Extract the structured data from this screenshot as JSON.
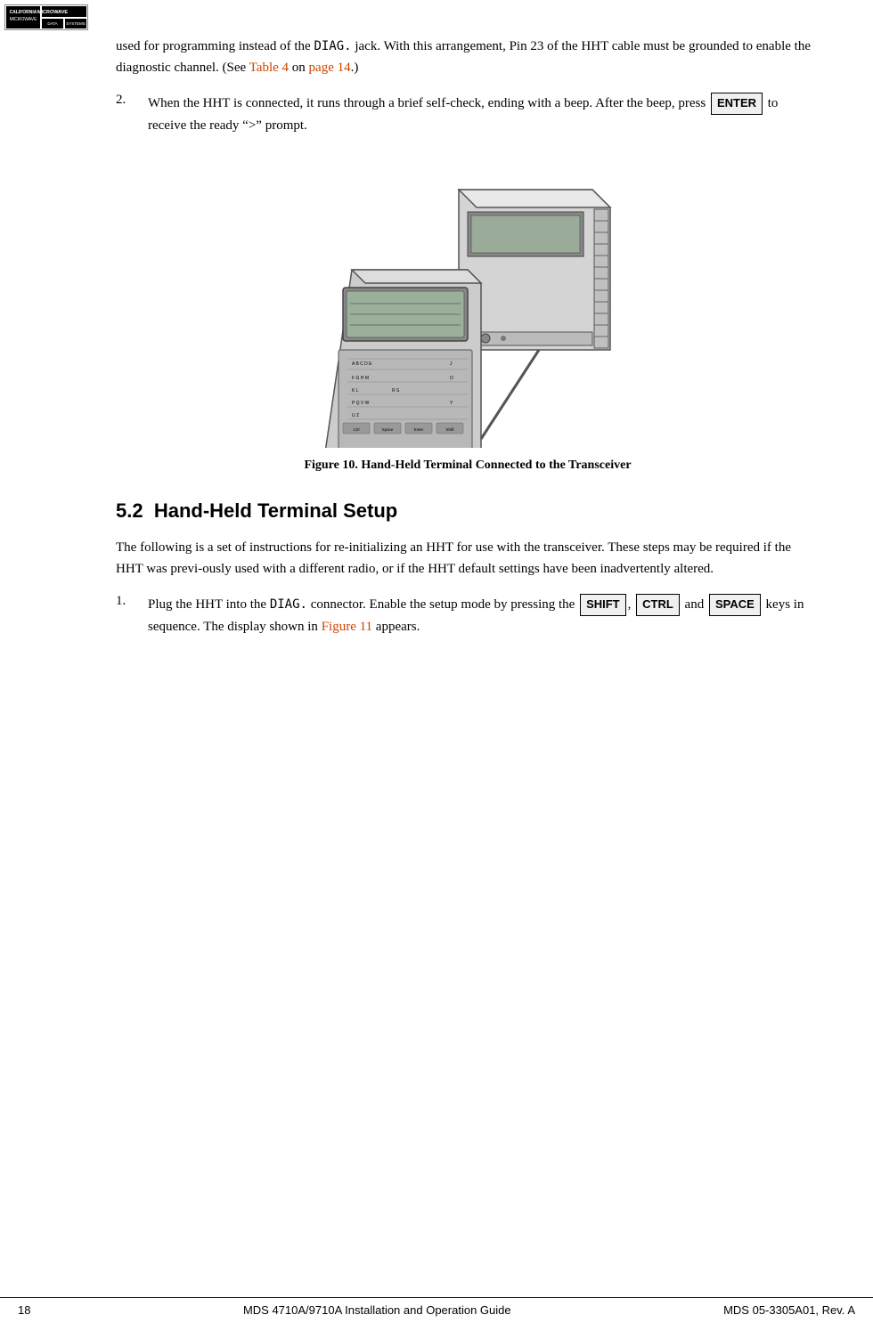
{
  "logo": {
    "line1": "CALIFORNIA",
    "line2": "MicrOWAVE",
    "line3": "DATA",
    "line4": "SYSTEMS"
  },
  "content": {
    "intro_para": "used for programming instead of the DIAG. jack. With this arrange-ment, Pin 23 of the HHT cable must be grounded to enable the diag-nostic channel. (See Table 4 on page 14.)",
    "table_link": "Table 4",
    "page_link": "page 14",
    "item2_text_pre": "When the HHT is connected, it runs through a brief self-check, ending with a beep. After the beep, press ",
    "item2_key": "ENTER",
    "item2_text_post": " to receive the ready “>” prompt.",
    "figure_caption": "Figure 10. Hand-Held Terminal Connected to the Transceiver",
    "section_number": "5.2",
    "section_title": "Hand-Held Terminal Setup",
    "section_para": "The following is a set of instructions for re-initializing an HHT for use with the transceiver. These steps may be required if the HHT was previ-ously used with a different radio, or if the HHT default settings have been inadvertently altered.",
    "item1_text_pre": "Plug the HHT into the DIAG. connector. Enable the setup mode by pressing the ",
    "item1_key1": "SHIFT",
    "item1_comma": ",",
    "item1_key2": "CTRL",
    "item1_and": " and ",
    "item1_key3": "SPACE",
    "item1_text_post": " keys in sequence. The display shown in ",
    "item1_figure_link": "Figure 11",
    "item1_text_end": " appears.",
    "footer_page": "18",
    "footer_center": "MDS 4710A/9710A Installation and Operation Guide",
    "footer_right": "MDS 05-3305A01, Rev. A"
  }
}
